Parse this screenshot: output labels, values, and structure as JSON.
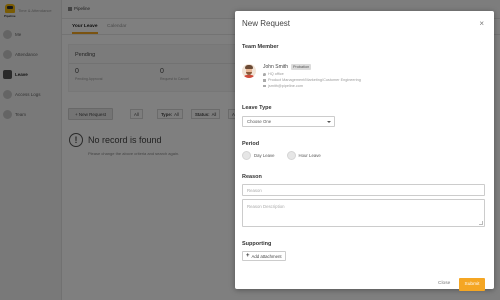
{
  "brand": {
    "name": "Time & Attendance",
    "logo_sub": "Pipeline"
  },
  "sidebar": {
    "items": [
      {
        "label": "Me",
        "icon": "user-icon"
      },
      {
        "label": "Attendance",
        "icon": "clock-icon"
      },
      {
        "label": "Leave",
        "icon": "calendar-icon"
      },
      {
        "label": "Access Logs",
        "icon": "key-icon"
      },
      {
        "label": "Team",
        "icon": "team-icon"
      }
    ]
  },
  "topbar": {
    "crumb": "Pipeline"
  },
  "tabs": [
    {
      "label": "Your Leave"
    },
    {
      "label": "Calendar"
    }
  ],
  "pending": {
    "title": "Pending",
    "stats": [
      {
        "value": "0",
        "label": "Pending Approval"
      },
      {
        "value": "0",
        "label": "Request to Cancel"
      }
    ]
  },
  "toolbar": {
    "new_request": "+ New Request",
    "filter_all": "All",
    "type_label": "Type:",
    "type_value": "All",
    "status_label": "Status:",
    "status_value": "All",
    "more": "All"
  },
  "empty": {
    "icon_glyph": "!",
    "title": "No record is found",
    "subtitle": "Please change the above criteria and search again."
  },
  "modal": {
    "title": "New Request",
    "close_glyph": "×",
    "team_member_label": "Team Member",
    "member": {
      "name": "John Smith",
      "badge": "Probation",
      "office": "HQ office",
      "department": "Product Management/Marketing/Customer Engineering",
      "email": "jsmith@pipeline.com"
    },
    "leave_type_label": "Leave Type",
    "leave_type_value": "Choose One",
    "period_label": "Period",
    "period_options": [
      "Day Leave",
      "Hour Leave"
    ],
    "reason_label": "Reason",
    "reason_placeholder": "Reason",
    "description_placeholder": "Reason Description",
    "supporting_label": "Supporting",
    "attach_label": "Add attachment",
    "attach_glyph": "+",
    "close_label": "Close",
    "submit_label": "Submit",
    "accent_color": "#f5a623"
  }
}
